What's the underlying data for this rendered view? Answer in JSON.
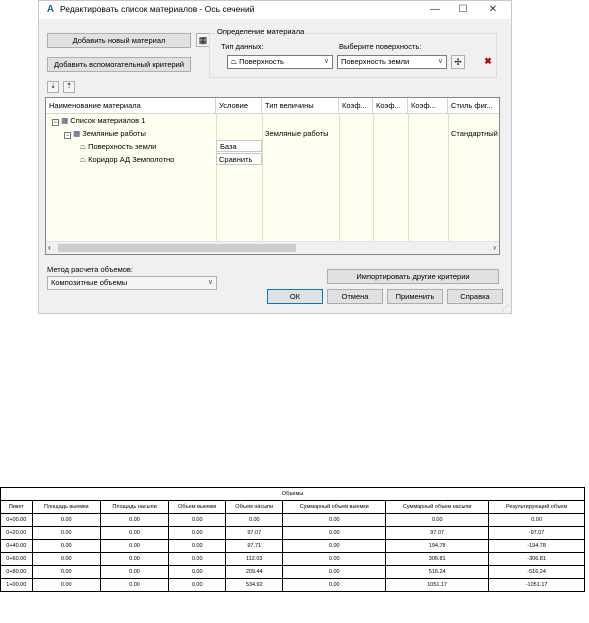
{
  "dialog": {
    "title": "Редактировать список материалов - Ось сечений",
    "add_material_btn": "Добавить новый материал",
    "add_criteria_btn": "Добавить вспомогательный критерий",
    "material_def_group": "Определение материала",
    "data_type_label": "Тип данных:",
    "data_type_value": "Поверхность",
    "surface_label": "Выберите поверхность:",
    "surface_value": "Поверхность земли",
    "grid": {
      "headers": [
        "Наименование материала",
        "Условие",
        "Тип величины",
        "Коэф...",
        "Коэф...",
        "Коэф...",
        "Стиль фиг..."
      ],
      "rows": {
        "list": "Список материалов 1",
        "earthworks": "Земляные работы",
        "earthworks_type": "Земляные работы",
        "earthworks_style": "Стандартный",
        "surface": "Поверхность земли",
        "surface_cond": "База",
        "corridor": "Коридор АД Земполотно",
        "corridor_cond": "Сравнить"
      }
    },
    "volume_method_label": "Метод расчета объемов:",
    "volume_method_value": "Композитные объемы",
    "import_btn": "Импортировать другие критерии",
    "ok_btn": "ОК",
    "cancel_btn": "Отмена",
    "apply_btn": "Применить",
    "help_btn": "Справка"
  },
  "table": {
    "title": "Объемы",
    "headers": [
      "Пикет",
      "Площадь выемки",
      "Площадь насыпи",
      "Объем выемки",
      "Объем насыпи",
      "Суммарный объем выемки",
      "Суммарный объем насыпи",
      "Результирующий объем"
    ],
    "rows": [
      [
        "0+00.00",
        "0.00",
        "0.00",
        "0.00",
        "0.00",
        "0.00",
        "0.00",
        "0.00"
      ],
      [
        "0+20.00",
        "0.00",
        "0.00",
        "0.00",
        "97.07",
        "0.00",
        "97.07",
        "-97.07"
      ],
      [
        "0+40.00",
        "0.00",
        "0.00",
        "0.00",
        "97.71",
        "0.00",
        "194.78",
        "-194.78"
      ],
      [
        "0+60.00",
        "0.00",
        "0.00",
        "0.00",
        "112.03",
        "0.00",
        "306.81",
        "-306.81"
      ],
      [
        "0+80.00",
        "0.00",
        "0.00",
        "0.00",
        "209.44",
        "0.00",
        "516.24",
        "-516.24"
      ],
      [
        "1+00.00",
        "0.00",
        "0.00",
        "0.00",
        "534.92",
        "0.00",
        "1051.17",
        "-1051.17"
      ]
    ]
  },
  "colors": {
    "grid_bg": "#fffff0",
    "accent": "#0078d7",
    "delete": "#c00000"
  }
}
